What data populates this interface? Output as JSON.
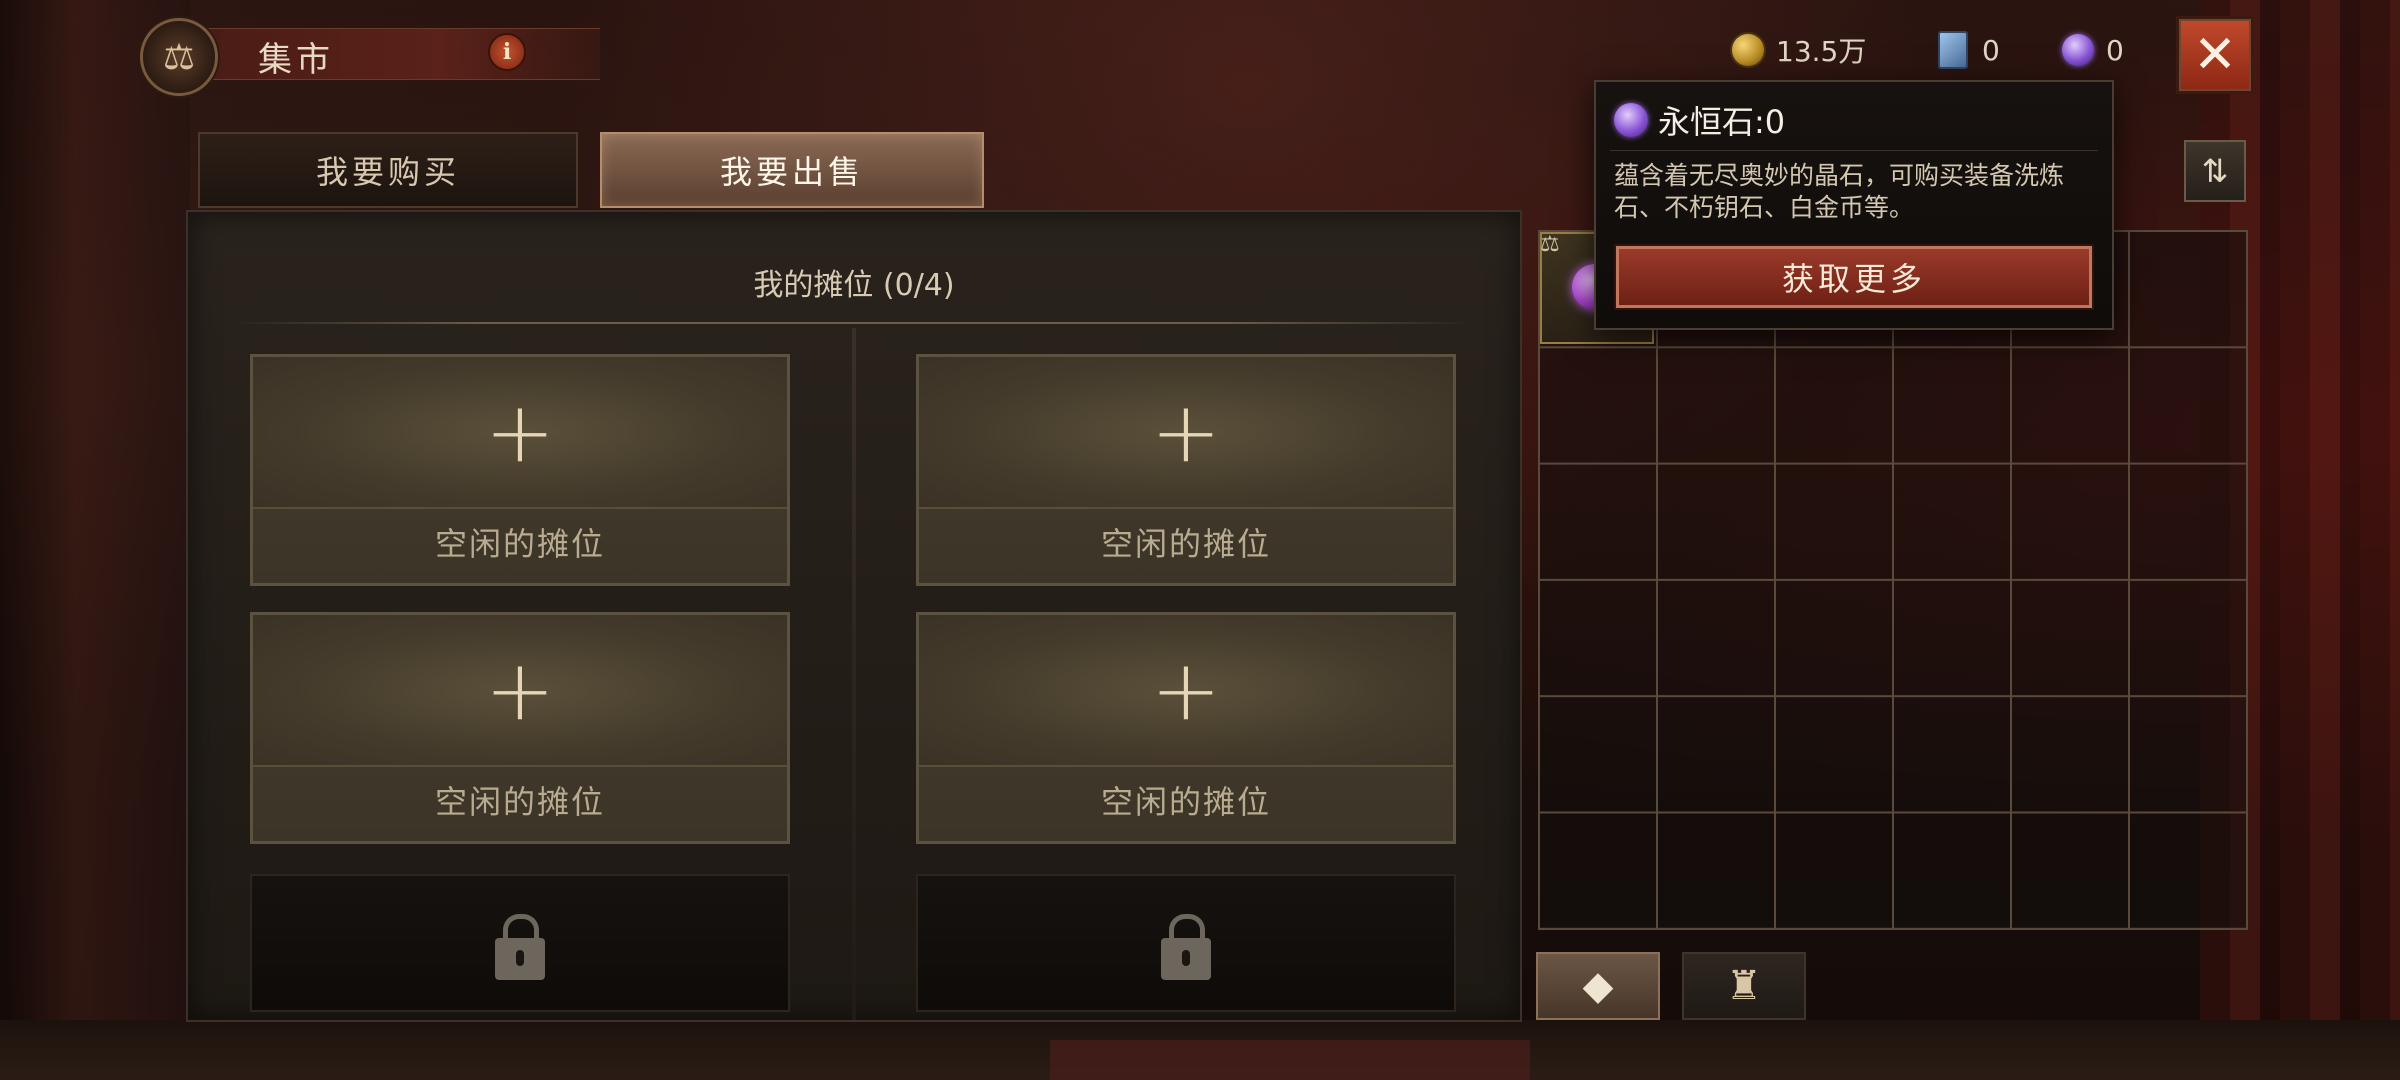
{
  "header": {
    "title": "集市",
    "title_icon": "scales-icon",
    "info_icon": "info-icon"
  },
  "currencies": [
    {
      "name": "gold",
      "icon": "gold-coin-icon",
      "value": "13.5万",
      "color": "#d8a83a"
    },
    {
      "name": "card",
      "icon": "blue-card-icon",
      "value": "0",
      "color": "#6f95c4"
    },
    {
      "name": "eternal-stone",
      "icon": "purple-gem-icon",
      "value": "0",
      "color": "#8a55d6"
    }
  ],
  "tabs": [
    {
      "label": "我要购买",
      "active": false
    },
    {
      "label": "我要出售",
      "active": true
    }
  ],
  "market": {
    "heading": "我的摊位 (0/4)",
    "slots": [
      {
        "label": "空闲的摊位",
        "state": "empty"
      },
      {
        "label": "空闲的摊位",
        "state": "empty"
      },
      {
        "label": "空闲的摊位",
        "state": "empty"
      },
      {
        "label": "空闲的摊位",
        "state": "empty"
      },
      {
        "label": "",
        "state": "locked"
      },
      {
        "label": "",
        "state": "locked"
      }
    ],
    "plus_glyph": "+"
  },
  "tooltip": {
    "title": "永恒石:0",
    "description": "蕴含着无尽奥妙的晶石，可购买装备洗炼石、不朽钥石、白金币等。",
    "button_label": "获取更多"
  },
  "inventory": {
    "columns": 6,
    "rows": 6,
    "tag_icon": "scales-small-icon",
    "sort_icon": "sort-icon",
    "bottom_tabs": [
      {
        "icon": "gems-icon",
        "active": true
      },
      {
        "icon": "bag-icon",
        "active": false
      }
    ]
  },
  "colors": {
    "accent_red": "#9a3a2a",
    "panel": "#2a231d",
    "text_light": "#e8d9c2"
  }
}
